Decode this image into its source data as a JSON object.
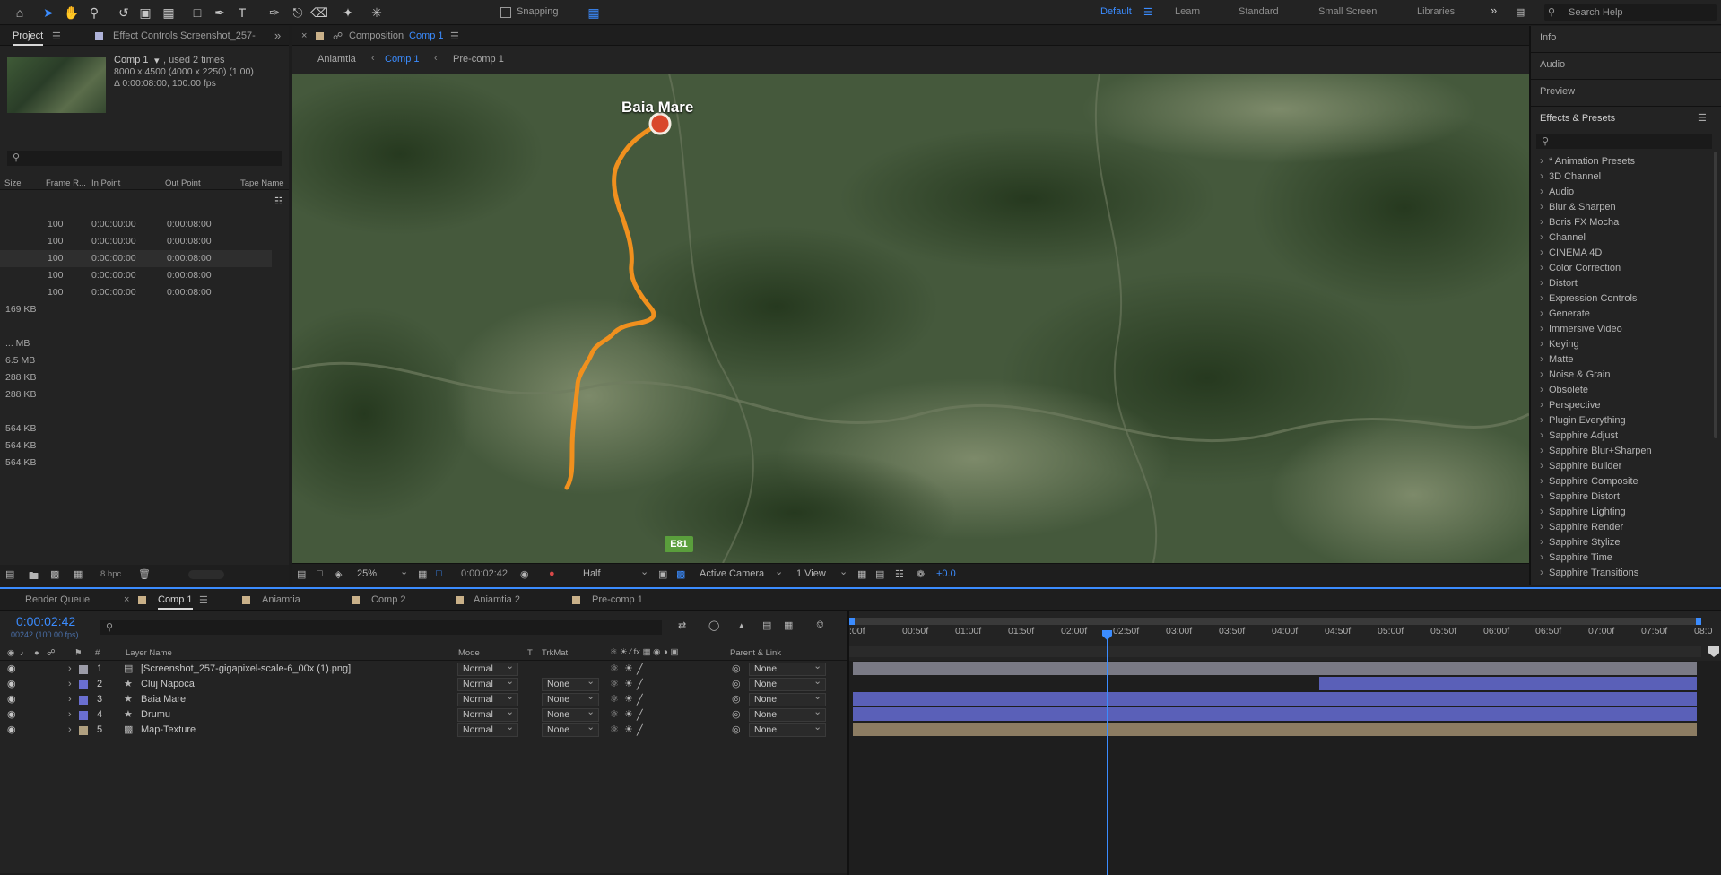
{
  "toolbar": {
    "snapping_label": "Snapping",
    "workspaces": [
      {
        "label": "Default",
        "active": true
      },
      {
        "label": "Learn",
        "active": false
      },
      {
        "label": "Standard",
        "active": false
      },
      {
        "label": "Small Screen",
        "active": false
      },
      {
        "label": "Libraries",
        "active": false
      }
    ],
    "search_placeholder": "Search Help"
  },
  "project_panel": {
    "tabs": [
      "Project",
      "Effect Controls Screenshot_257-"
    ],
    "item_name": "Comp 1",
    "item_usage": ", used 2 times",
    "item_dims": "8000 x 4500  (4000 x 2250) (1.00)",
    "item_duration": "Δ 0:00:08:00, 100.00 fps",
    "columns": [
      "Size",
      "Frame R...",
      "In Point",
      "Out Point",
      "Tape Name"
    ],
    "rows": [
      {
        "size": "",
        "fps": "100",
        "in": "0:00:00:00",
        "out": "0:00:08:00"
      },
      {
        "size": "",
        "fps": "100",
        "in": "0:00:00:00",
        "out": "0:00:08:00"
      },
      {
        "size": "",
        "fps": "100",
        "in": "0:00:00:00",
        "out": "0:00:08:00"
      },
      {
        "size": "",
        "fps": "100",
        "in": "0:00:00:00",
        "out": "0:00:08:00"
      },
      {
        "size": "",
        "fps": "100",
        "in": "0:00:00:00",
        "out": "0:00:08:00"
      },
      {
        "size": "169 KB",
        "fps": "",
        "in": "",
        "out": ""
      },
      {
        "size": "",
        "fps": "",
        "in": "",
        "out": ""
      },
      {
        "size": "... MB",
        "fps": "",
        "in": "",
        "out": ""
      },
      {
        "size": "6.5 MB",
        "fps": "",
        "in": "",
        "out": ""
      },
      {
        "size": "288 KB",
        "fps": "",
        "in": "",
        "out": ""
      },
      {
        "size": "288 KB",
        "fps": "",
        "in": "",
        "out": ""
      },
      {
        "size": "",
        "fps": "",
        "in": "",
        "out": ""
      },
      {
        "size": "564 KB",
        "fps": "",
        "in": "",
        "out": ""
      },
      {
        "size": "564 KB",
        "fps": "",
        "in": "",
        "out": ""
      },
      {
        "size": "564 KB",
        "fps": "",
        "in": "",
        "out": ""
      }
    ],
    "bpc_label": "8 bpc"
  },
  "composition": {
    "panel_label": "Composition",
    "panel_comp": "Comp 1",
    "breadcrumbs": [
      "Aniamtia",
      "Comp 1",
      "Pre-comp 1"
    ],
    "active_crumb": "Comp 1",
    "map_label": "Baia Mare",
    "road_badge": "E81",
    "zoom": "25%",
    "timecode": "0:00:02:42",
    "resolution": "Half",
    "camera": "Active Camera",
    "views": "1 View",
    "exposure": "+0.0"
  },
  "right_panel": {
    "sections": [
      "Info",
      "Audio",
      "Preview",
      "Effects & Presets"
    ],
    "effects": [
      "* Animation Presets",
      "3D Channel",
      "Audio",
      "Blur & Sharpen",
      "Boris FX Mocha",
      "Channel",
      "CINEMA 4D",
      "Color Correction",
      "Distort",
      "Expression Controls",
      "Generate",
      "Immersive Video",
      "Keying",
      "Matte",
      "Noise & Grain",
      "Obsolete",
      "Perspective",
      "Plugin Everything",
      "Sapphire Adjust",
      "Sapphire Blur+Sharpen",
      "Sapphire Builder",
      "Sapphire Composite",
      "Sapphire Distort",
      "Sapphire Lighting",
      "Sapphire Render",
      "Sapphire Stylize",
      "Sapphire Time",
      "Sapphire Transitions"
    ]
  },
  "timeline": {
    "tabs": [
      "Render Queue",
      "Comp 1",
      "Aniamtia",
      "Comp 2",
      "Aniamtia 2",
      "Pre-comp 1"
    ],
    "active_tab": "Comp 1",
    "current_time": "0:00:02:42",
    "current_frame": "00242 (100.00 fps)",
    "columns": {
      "num": "#",
      "layer_name": "Layer Name",
      "mode": "Mode",
      "t": "T",
      "trkmat": "TrkMat",
      "parent": "Parent & Link"
    },
    "layers": [
      {
        "num": "1",
        "name": "[Screenshot_257-gigapixel-scale-6_00x (1).png]",
        "mode": "Normal",
        "trkmat": "",
        "parent": "None",
        "color": "#9c9ca8",
        "bar_color": "#7a7a85",
        "start": 0.0,
        "end": 1.0
      },
      {
        "num": "2",
        "name": "Cluj Napoca",
        "mode": "Normal",
        "trkmat": "None",
        "parent": "None",
        "color": "#6a6fd0",
        "bar_color": "#5a60b8",
        "start": 0.55,
        "end": 1.0
      },
      {
        "num": "3",
        "name": "Baia Mare",
        "mode": "Normal",
        "trkmat": "None",
        "parent": "None",
        "color": "#6a6fd0",
        "bar_color": "#5a60b8",
        "start": 0.0,
        "end": 1.0
      },
      {
        "num": "4",
        "name": "Drumu",
        "mode": "Normal",
        "trkmat": "None",
        "parent": "None",
        "color": "#6a6fd0",
        "bar_color": "#5a60b8",
        "start": 0.0,
        "end": 1.0
      },
      {
        "num": "5",
        "name": "Map-Texture",
        "mode": "Normal",
        "trkmat": "None",
        "parent": "None",
        "color": "#b0a080",
        "bar_color": "#8c7c62",
        "start": 0.0,
        "end": 1.0
      }
    ],
    "ruler": [
      ":00f",
      "00:50f",
      "01:00f",
      "01:50f",
      "02:00f",
      "02:50f",
      "03:00f",
      "03:50f",
      "04:00f",
      "04:50f",
      "05:00f",
      "05:50f",
      "06:00f",
      "06:50f",
      "07:00f",
      "07:50f",
      "08:0"
    ],
    "playhead_fraction": 0.3025
  },
  "colors": {
    "accent": "#3b8cff",
    "route": "#f0901e",
    "marker": "#d9472b"
  }
}
